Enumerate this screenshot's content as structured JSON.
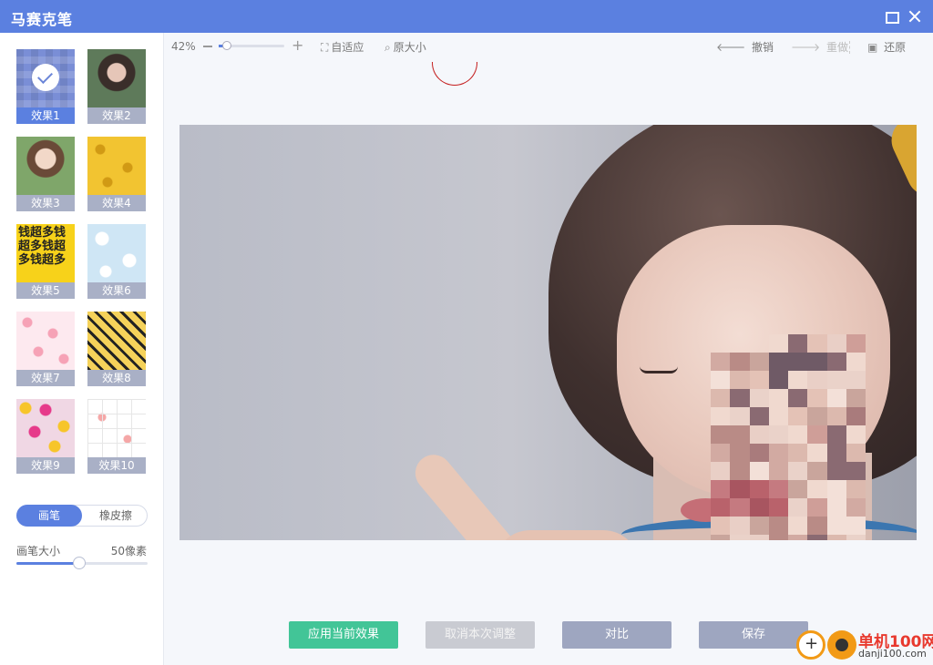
{
  "window": {
    "title": "马赛克笔"
  },
  "effects": [
    {
      "label": "效果1",
      "selected": true
    },
    {
      "label": "效果2",
      "selected": false
    },
    {
      "label": "效果3",
      "selected": false
    },
    {
      "label": "效果4",
      "selected": false
    },
    {
      "label": "效果5",
      "selected": false,
      "thumb_text": "钱超多钱超多钱超多钱超多"
    },
    {
      "label": "效果6",
      "selected": false
    },
    {
      "label": "效果7",
      "selected": false
    },
    {
      "label": "效果8",
      "selected": false
    },
    {
      "label": "效果9",
      "selected": false
    },
    {
      "label": "效果10",
      "selected": false
    }
  ],
  "tool_toggle": {
    "brush": "画笔",
    "eraser": "橡皮擦",
    "active": "brush"
  },
  "brush_size": {
    "label": "画笔大小",
    "value": "50像素",
    "fraction": 0.48
  },
  "toolbar": {
    "zoom_percent": "42%",
    "zoom_fraction": 0.12,
    "fit_label": "自适应",
    "original_label": "原大小",
    "undo_label": "撤销",
    "redo_label": "重做",
    "restore_label": "还原"
  },
  "buttons": {
    "apply": "应用当前效果",
    "cancel": "取消本次调整",
    "compare": "对比",
    "save": "保存"
  },
  "watermark": {
    "brand": "单机100网",
    "url": "danji100.com"
  },
  "colors": {
    "accent": "#5b80e0",
    "apply": "#42c597",
    "neutral": "#9ea6c0"
  }
}
